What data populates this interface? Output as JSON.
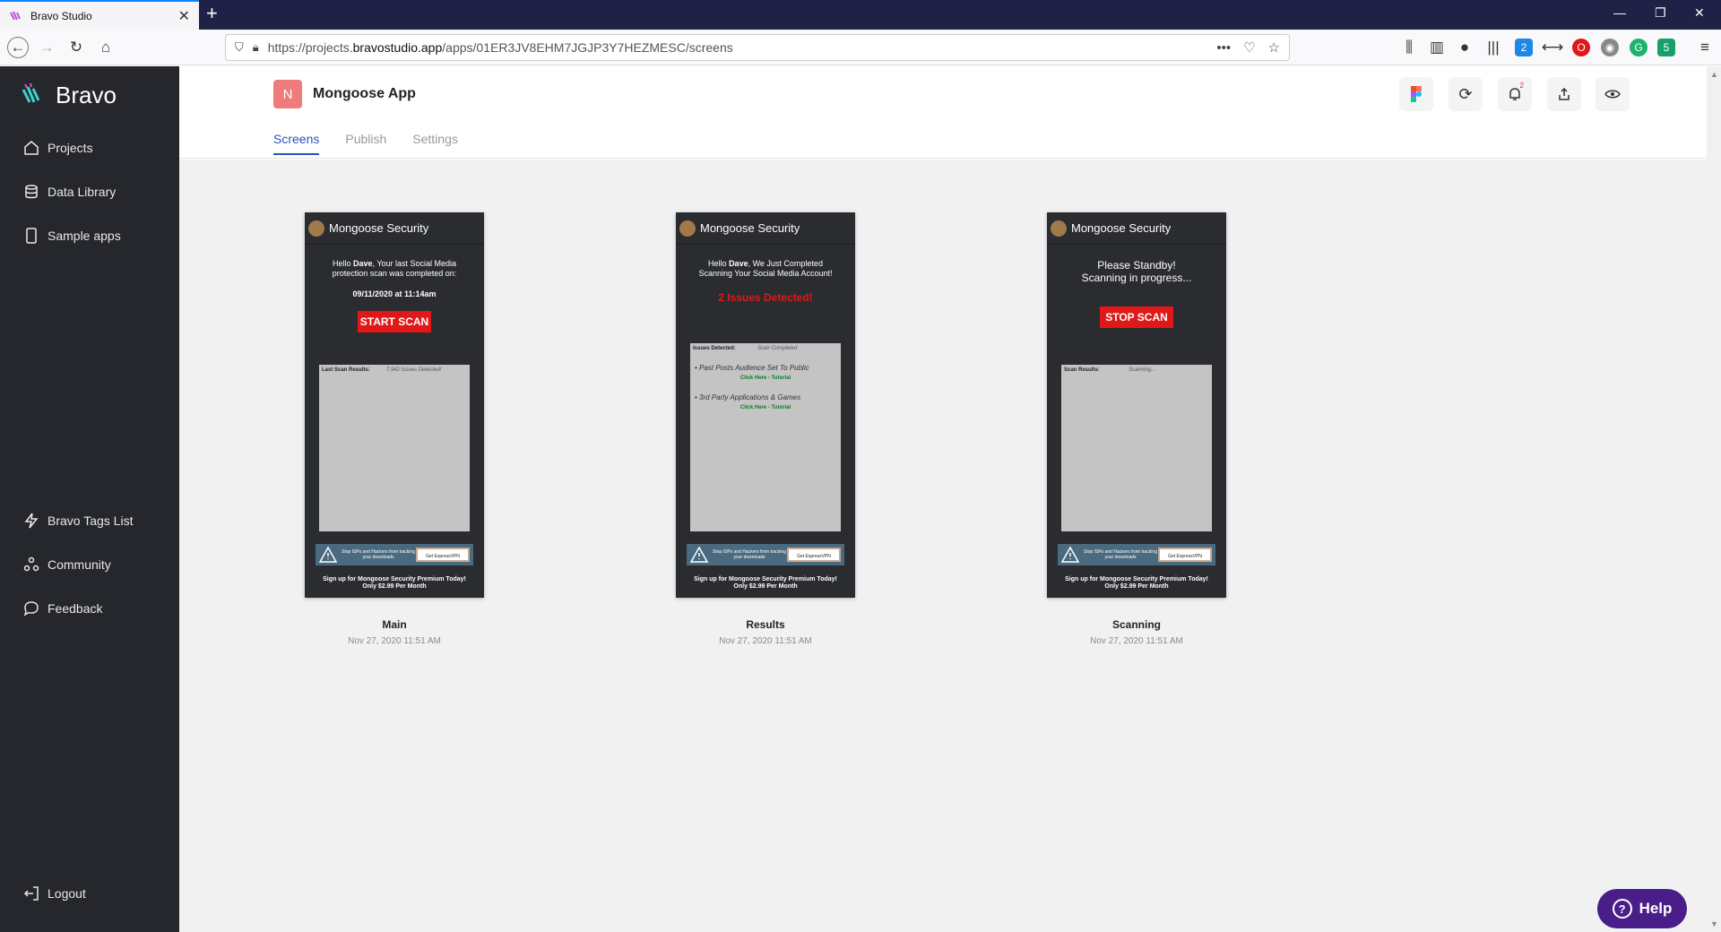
{
  "browser": {
    "tab_title": "Bravo Studio",
    "url_prefix": "https://projects.",
    "url_domain": "bravostudio.app",
    "url_path": "/apps/01ER3JV8EHM7JGJP3Y7HEZMESC/screens",
    "ext_badges": [
      "2",
      "5"
    ],
    "window_buttons": [
      "—",
      "❐",
      "✕"
    ]
  },
  "sidebar": {
    "logo": "Bravo",
    "items_top": [
      {
        "label": "Projects",
        "icon": "home-icon"
      },
      {
        "label": "Data Library",
        "icon": "database-icon"
      },
      {
        "label": "Sample apps",
        "icon": "phone-icon"
      }
    ],
    "items_bottom": [
      {
        "label": "Bravo Tags List",
        "icon": "lightning-icon"
      },
      {
        "label": "Community",
        "icon": "people-icon"
      },
      {
        "label": "Feedback",
        "icon": "chat-icon"
      }
    ],
    "logout": "Logout"
  },
  "header": {
    "app_initial": "N",
    "app_name": "Mongoose App",
    "tabs": [
      "Screens",
      "Publish",
      "Settings"
    ],
    "active_tab": "Screens",
    "notif_badge": "2"
  },
  "screens": [
    {
      "name": "Main",
      "date": "Nov 27, 2020 11:51 AM",
      "brand": "Mongoose Security",
      "greeting_pre": "Hello ",
      "greeting_name": "Dave",
      "greeting_post": ", Your last Social Media protection scan was completed on:",
      "scan_date": "09/11/2020 at 11:14am",
      "button": "START SCAN",
      "box_label": "Last Scan Results:",
      "box_value": "7,942 Issues Detected!",
      "ad_text": "Stop ISPs and Hackers from tracking your downloads",
      "ad_button": "Get ExpressVPN",
      "footer_line1": "Sign up for Mongoose Security Premium Today!",
      "footer_line2": "Only $2.99 Per Month"
    },
    {
      "name": "Results",
      "date": "Nov 27, 2020 11:51 AM",
      "brand": "Mongoose Security",
      "greeting_pre": "Hello ",
      "greeting_name": "Dave",
      "greeting_post": ", We Just Completed Scanning Your Social Media Account!",
      "alert": "2 Issues Detected!",
      "box_label": "Issues Detected:",
      "box_value": "Scan Completed",
      "issues": [
        {
          "text": "• Past Posts Audience Set To Public",
          "link": "Click Here - Tutorial"
        },
        {
          "text": "• 3rd Party Applications & Games",
          "link": "Click Here - Tutorial"
        }
      ],
      "ad_text": "Stop ISPs and Hackers from tracking your downloads",
      "ad_button": "Get ExpressVPN",
      "footer_line1": "Sign up for Mongoose Security Premium Today!",
      "footer_line2": "Only $2.99 Per Month"
    },
    {
      "name": "Scanning",
      "date": "Nov 27, 2020 11:51 AM",
      "brand": "Mongoose Security",
      "message_line1": "Please Standby!",
      "message_line2": "Scanning in progress...",
      "button": "STOP SCAN",
      "box_label": "Scan Results:",
      "box_value": "Scanning...",
      "ad_text": "Stop ISPs and Hackers from tracking your downloads",
      "ad_button": "Get ExpressVPN",
      "footer_line1": "Sign up for Mongoose Security Premium Today!",
      "footer_line2": "Only $2.99 Per Month"
    }
  ],
  "help_label": "Help",
  "colors": {
    "sidebar_bg": "#25272c",
    "active_tab": "#2a55b9",
    "scan_button": "#e11818",
    "help_bg": "#4a1e88",
    "app_avatar": "#f07b7b"
  }
}
